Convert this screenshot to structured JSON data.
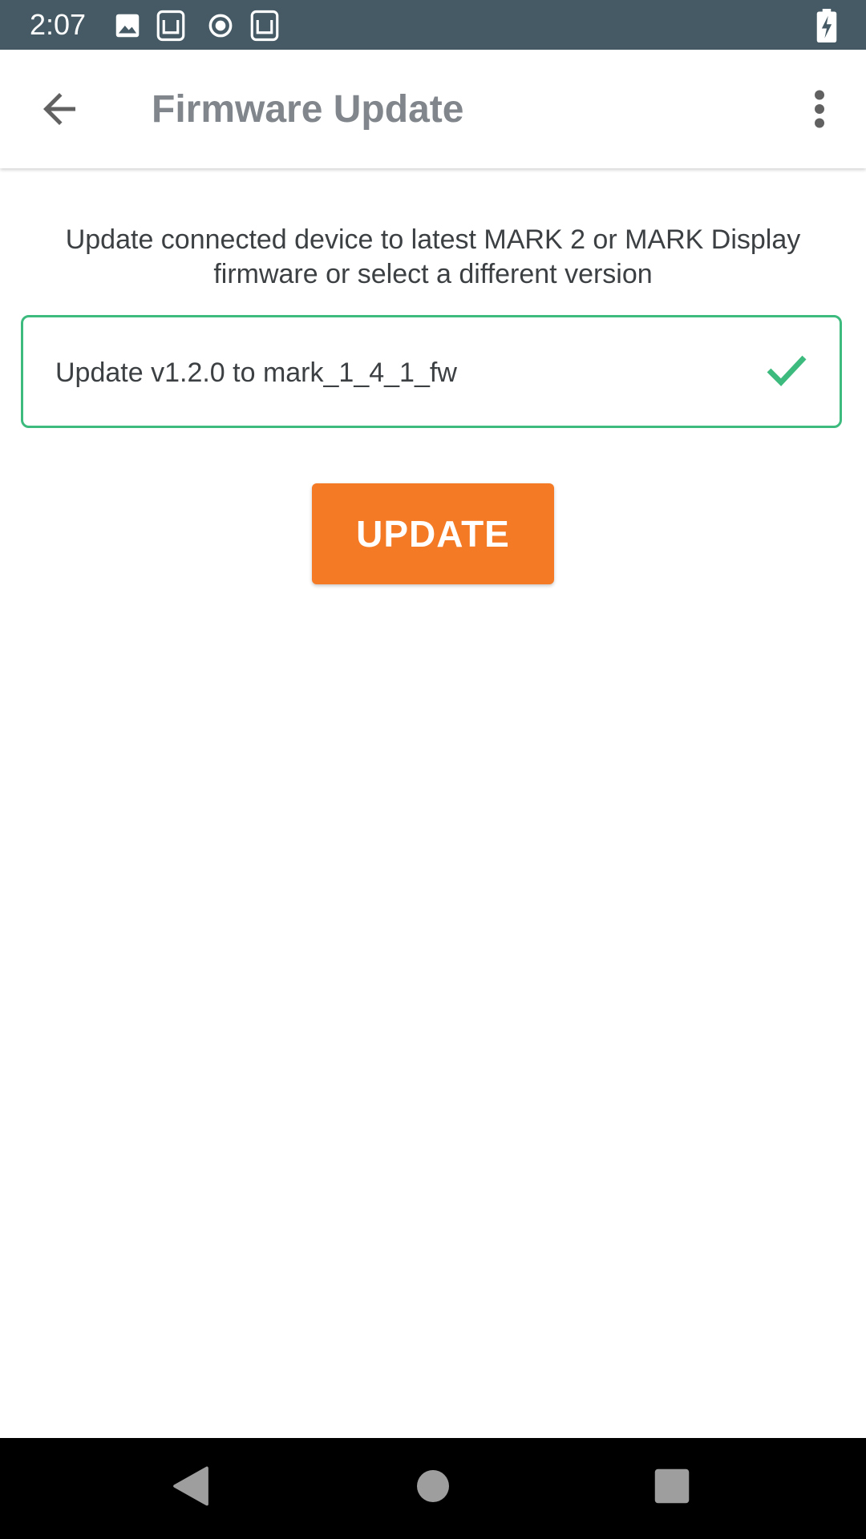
{
  "status_bar": {
    "time": "2:07",
    "icons": [
      "image-icon",
      "sd-card-icon",
      "record-icon",
      "sd-card-icon",
      "battery-charging-icon"
    ],
    "background_color": "#455a64"
  },
  "app_bar": {
    "title": "Firmware Update",
    "back_icon": "arrow-back-icon",
    "menu_icon": "more-vert-icon"
  },
  "main": {
    "description": "Update connected device to latest MARK 2 or MARK Display firmware or select a different version",
    "firmware_option": {
      "label": "Update v1.2.0 to mark_1_4_1_fw",
      "selected": true,
      "accent_color": "#3dbb7e"
    },
    "update_button": {
      "label": "UPDATE",
      "color": "#f57a25"
    }
  },
  "nav_bar": {
    "icons": [
      "nav-back-icon",
      "nav-home-icon",
      "nav-recents-icon"
    ]
  }
}
